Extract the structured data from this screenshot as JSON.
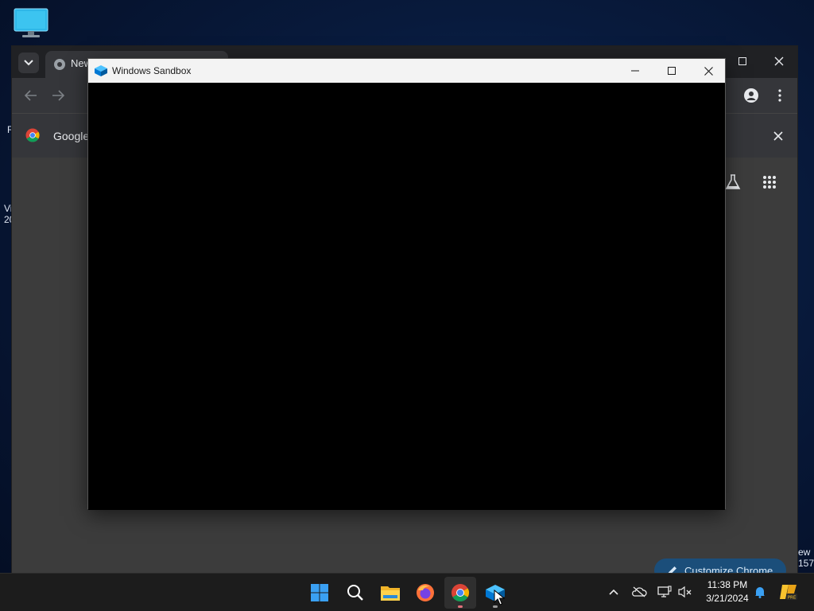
{
  "desktop": {
    "icon_name": "this-pc-icon",
    "left_fragments": [
      "R",
      "Vi",
      "20"
    ],
    "right_fragments": [
      "ew",
      "157"
    ]
  },
  "chrome": {
    "tab_title": "New",
    "info_text": "Google",
    "customize_label": "Customize Chrome"
  },
  "sandbox": {
    "title": "Windows Sandbox"
  },
  "taskbar": {
    "apps": [
      "start-icon",
      "search-icon",
      "file-explorer-icon",
      "firefox-icon",
      "chrome-icon",
      "windows-sandbox-icon"
    ],
    "clock_time": "11:38 PM",
    "clock_date": "3/21/2024"
  }
}
